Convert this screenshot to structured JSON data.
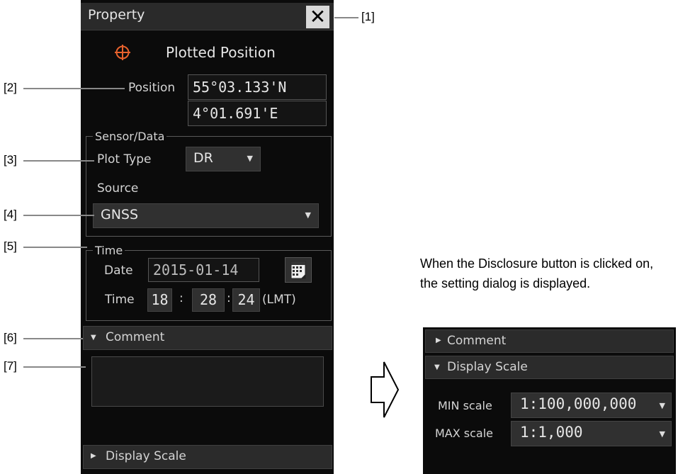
{
  "dialog": {
    "title": "Property",
    "close_glyph": "✕",
    "object_label": "Plotted Position",
    "object_icon": "crosshair-circle-icon",
    "object_icon_color": "#e8622d",
    "position": {
      "label": "Position",
      "lat": "55°03.133'N",
      "lon": "4°01.691'E"
    },
    "sensor_group": {
      "legend": "Sensor/Data",
      "plot_type_label": "Plot Type",
      "plot_type_value": "DR",
      "source_label": "Source",
      "source_value": "GNSS"
    },
    "time_group": {
      "legend": "Time",
      "date_label": "Date",
      "date_value": "2015-01-14",
      "time_label": "Time",
      "hh": "18",
      "mm": "28",
      "ss": "24",
      "sep": ":",
      "zone": "(LMT)"
    },
    "comment_bar": "Comment",
    "display_scale_bar": "Display Scale"
  },
  "callouts": [
    "[1]",
    "[2]",
    "[3]",
    "[4]",
    "[5]",
    "[6]",
    "[7]"
  ],
  "note": "When the Disclosure button is clicked on, the setting dialog is displayed.",
  "expanded": {
    "comment_bar": "Comment",
    "display_scale_bar": "Display Scale",
    "min_label": "MIN scale",
    "min_value": "1:100,000,000",
    "max_label": "MAX scale",
    "max_value": "1:1,000"
  }
}
